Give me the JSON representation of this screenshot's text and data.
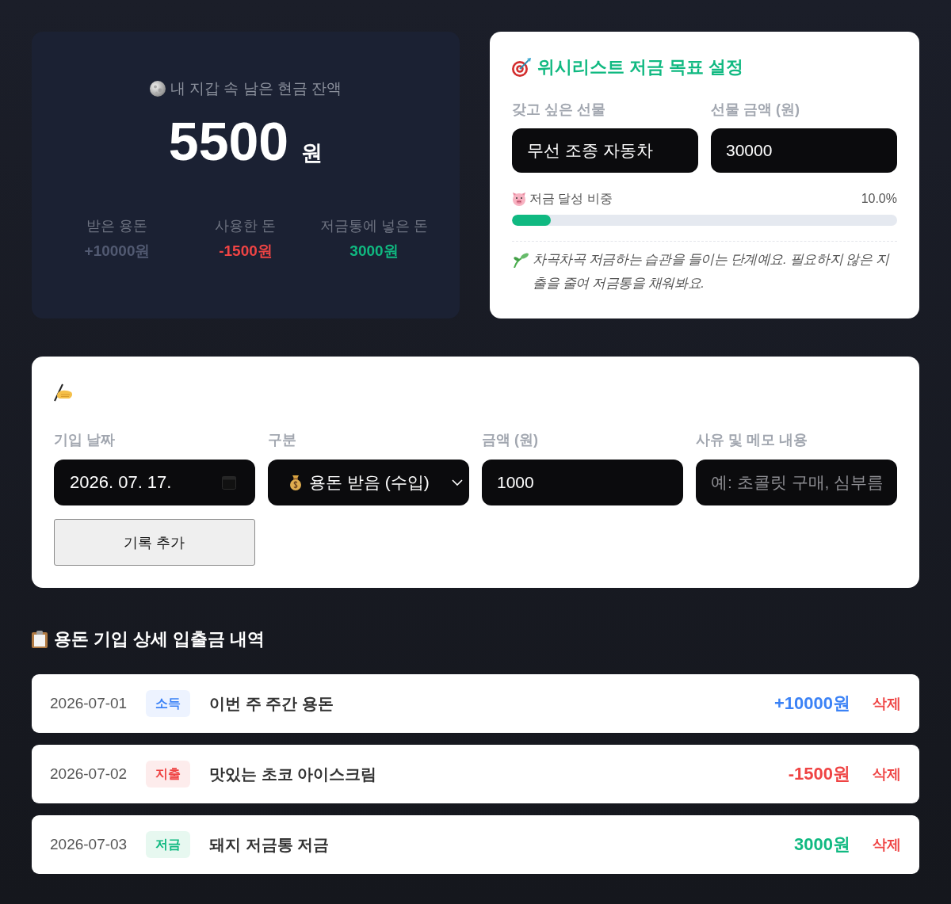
{
  "balance_card": {
    "title": "내 지갑 속 남은 현금 잔액",
    "amount": "5500",
    "unit": "원",
    "stats": [
      {
        "kind": "income",
        "label": "받은 용돈",
        "value": "+10000원"
      },
      {
        "kind": "expense",
        "label": "사용한 돈",
        "value": "-1500원"
      },
      {
        "kind": "saving",
        "label": "저금통에 넣은 돈",
        "value": "3000원"
      }
    ]
  },
  "wishlist": {
    "title": "위시리스트 저금 목표 설정",
    "fields": [
      {
        "label": "갖고 싶은 선물",
        "value": "무선 조종 자동차"
      },
      {
        "label": "선물 금액 (원)",
        "value": "30000"
      }
    ],
    "progress": {
      "label": "저금 달성 비중",
      "reading": "10.0%",
      "level": 0.1
    },
    "message": "차곡차곡 저금하는 습관을 들이는 단계예요. 필요하지 않은 지출을 줄여 저금통을 채워봐요."
  },
  "entry_form": {
    "fields": [
      {
        "kind": "date",
        "label": "기입 날짜",
        "value": "2026. 07. 17."
      },
      {
        "kind": "select",
        "label": "구분",
        "value": "용돈 받음 (수입)"
      },
      {
        "kind": "text",
        "label": "금액 (원)",
        "value": "1000"
      },
      {
        "kind": "text",
        "label": "사유 및 메모 내용",
        "placeholder": "예: 초콜릿 구매, 심부름"
      }
    ],
    "submit": "기록 추가"
  },
  "history": {
    "title": "용돈 기입 상세 입출금 내역",
    "rows": [
      {
        "kind": "income",
        "date": "2026-07-01",
        "tag": "소득",
        "description": "이번 주 주간 용돈",
        "amount": "+10000원",
        "action": "삭제"
      },
      {
        "kind": "expense",
        "date": "2026-07-02",
        "tag": "지출",
        "description": "맛있는 초코 아이스크림",
        "amount": "-1500원",
        "action": "삭제"
      },
      {
        "kind": "saving",
        "date": "2026-07-03",
        "tag": "저금",
        "description": "돼지 저금통 저금",
        "amount": "3000원",
        "action": "삭제"
      }
    ]
  }
}
